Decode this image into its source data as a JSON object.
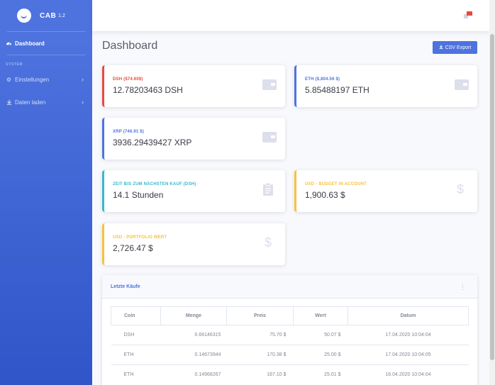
{
  "brand": {
    "name": "CAB",
    "version": "1.2"
  },
  "sidebar": {
    "items": [
      {
        "label": "Dashboard",
        "icon": "dashboard-icon"
      }
    ],
    "heading": "SYSTEM",
    "sub_items": [
      {
        "label": "Einstellungen",
        "icon": "gear-icon"
      },
      {
        "label": "Daten laden",
        "icon": "download-icon"
      }
    ]
  },
  "header": {
    "title": "Dashboard",
    "export_label": "CSV Export"
  },
  "cards": [
    {
      "label": "DSH ($74.60$)",
      "value": "12.78203463 DSH",
      "icon": "wallet-icon",
      "color": "#e74a3b"
    },
    {
      "label": "ETH ($,804.56 $)",
      "value": "5.85488197 ETH",
      "icon": "wallet-icon",
      "color": "#4e73df"
    },
    {
      "label": "XRP (746.91 $)",
      "value": "3936.29439427 XRP",
      "icon": "wallet-icon",
      "color": "#4e73df"
    },
    {
      "label": "ZEIT BIS ZUM NÄCHSTEN KAUF (DSH)",
      "value": "14.1 Stunden",
      "icon": "clipboard-icon",
      "color": "#36b9cc"
    },
    {
      "label": "USD - BUDGET IN ACCOUNT",
      "value": "1,900.63 $",
      "icon": "dollar-icon",
      "color": "#f6c23e"
    },
    {
      "label": "USD - PORTFOLIO WERT",
      "value": "2,726.47 $",
      "icon": "dollar-icon",
      "color": "#f6c23e"
    }
  ],
  "purchases": {
    "title": "Letzte Käufe",
    "headers": [
      "Coin",
      "Menge",
      "Preis",
      "Wert",
      "Datum"
    ],
    "rows": [
      {
        "coin": "DSH",
        "menge": "0.66146315",
        "preis": "75.70 $",
        "wert": "50.07 $",
        "datum": "17.04.2020 10:04:04"
      },
      {
        "coin": "ETH",
        "menge": "0.14673944",
        "preis": "170.38 $",
        "wert": "25.00 $",
        "datum": "17.04.2020 10:04:05"
      },
      {
        "coin": "ETH",
        "menge": "0.14968267",
        "preis": "167.10 $",
        "wert": "25.01 $",
        "datum": "16.04.2020 10:04:04"
      }
    ]
  },
  "colors": {
    "primary": "#4e73df",
    "danger": "#e74a3b",
    "info": "#36b9cc",
    "warning": "#f6c23e"
  }
}
